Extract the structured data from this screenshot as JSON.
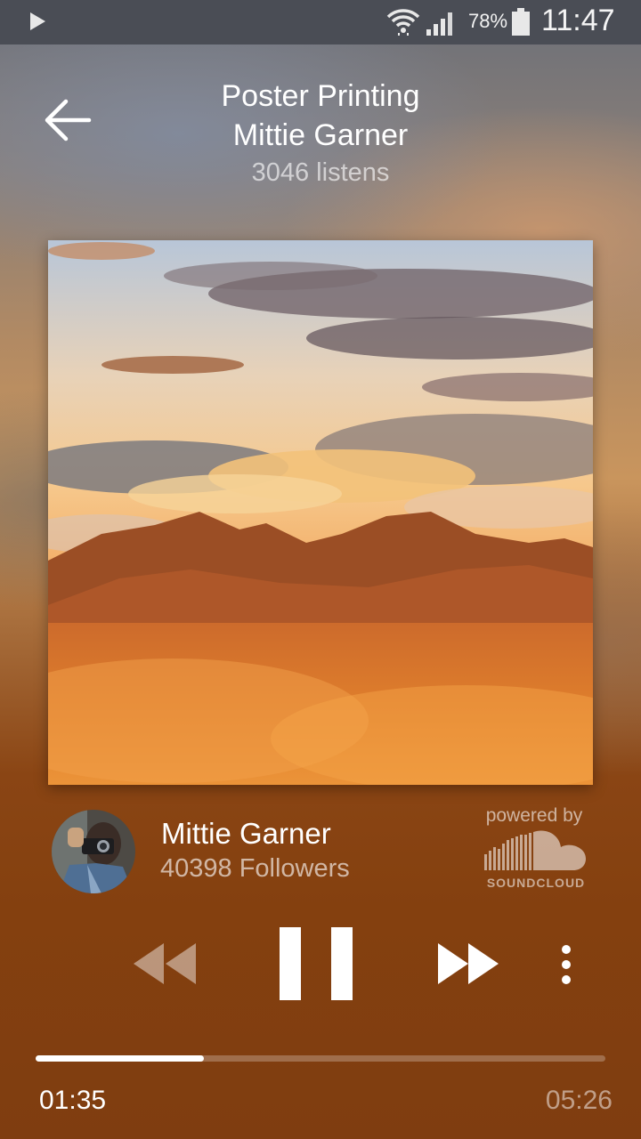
{
  "status_bar": {
    "battery_percent": "78%",
    "time": "11:47",
    "icons": [
      "play-icon",
      "wifi-icon",
      "signal-icon",
      "battery-icon"
    ]
  },
  "header": {
    "track_title": "Poster Printing",
    "artist_name": "Mittie Garner",
    "listens": "3046 listens",
    "back_icon": "arrow-left-icon"
  },
  "artwork": {
    "icon": "album-artwork"
  },
  "artist": {
    "name": "Mittie Garner",
    "followers": "40398 Followers",
    "avatar": "avatar"
  },
  "branding": {
    "powered_by": "powered by",
    "logo_text": "SOUNDCLOUD"
  },
  "controls": {
    "rewind_icon": "rewind-icon",
    "pause_icon": "pause-icon",
    "forward_icon": "fast-forward-icon",
    "more_icon": "more-vertical-icon"
  },
  "progress": {
    "elapsed": "01:35",
    "duration": "05:26",
    "fraction": 0.295
  },
  "colors": {
    "status_bar": "#4a4d55",
    "background_dark": "#7f3d10",
    "text_primary": "#ffffff"
  }
}
